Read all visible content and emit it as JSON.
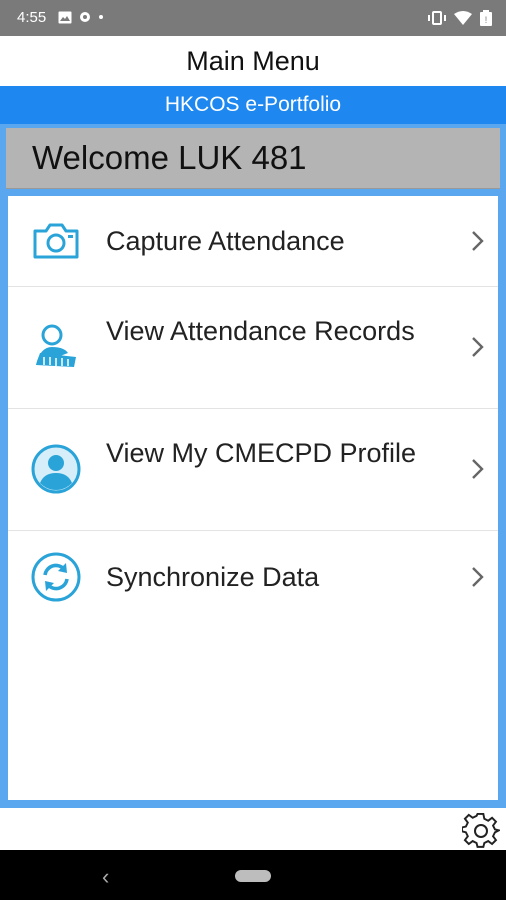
{
  "status_bar": {
    "time": "4:55",
    "left_icons": [
      "image-icon",
      "settings-small-icon",
      "dot-icon"
    ],
    "right_icons": [
      "vibrate-icon",
      "wifi-icon",
      "battery-icon"
    ]
  },
  "header": {
    "title": "Main Menu",
    "subtitle": "HKCOS e-Portfolio"
  },
  "welcome": {
    "text": "Welcome LUK 481"
  },
  "menu": {
    "items": [
      {
        "label": "Capture Attendance",
        "icon": "camera-icon"
      },
      {
        "label": "View Attendance Records",
        "icon": "attendance-records-icon"
      },
      {
        "label": "View My CMECPD Profile",
        "icon": "profile-icon"
      },
      {
        "label": "Synchronize Data",
        "icon": "sync-icon"
      }
    ]
  },
  "bottom": {
    "icon": "gear-icon"
  },
  "colors": {
    "accent_blue": "#1e88f0",
    "frame_blue": "#5aa7ef",
    "icon_teal": "#2aa4d8",
    "welcome_gray": "#b4b4b4"
  }
}
